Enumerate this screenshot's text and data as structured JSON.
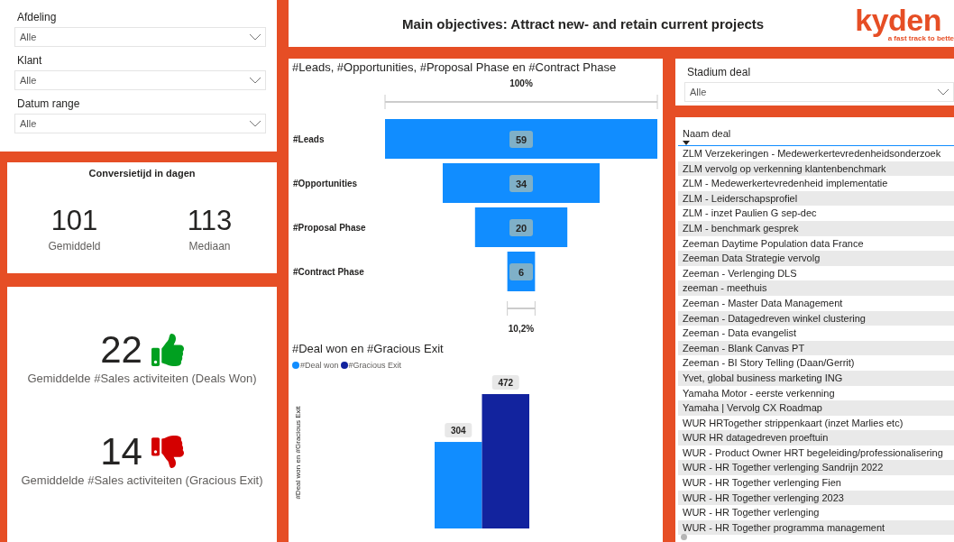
{
  "filters": [
    {
      "label": "Afdeling",
      "value": "Alle"
    },
    {
      "label": "Klant",
      "value": "Alle"
    },
    {
      "label": "Datum range",
      "value": "Alle"
    }
  ],
  "conversion": {
    "title": "Conversietijd in dagen",
    "stats": [
      {
        "value": "101",
        "label": "Gemiddeld"
      },
      {
        "value": "113",
        "label": "Mediaan"
      }
    ]
  },
  "sales_activities": [
    {
      "value": "22",
      "label": "Gemiddelde #Sales activiteiten (Deals Won)",
      "kind": "up"
    },
    {
      "value": "14",
      "label": "Gemiddelde #Sales activiteiten (Gracious Exit)",
      "kind": "down"
    }
  ],
  "header": {
    "title": "Main objectives: Attract new- and retain current projects",
    "logo": "kyden",
    "tagline": "a fast track to bette"
  },
  "funnel": {
    "title": "#Leads, #Opportunities, #Proposal Phase en #Contract Phase",
    "top_label": "100%",
    "bottom_label": "10,2%",
    "stages": [
      {
        "label": "#Leads",
        "value": "59"
      },
      {
        "label": "#Opportunities",
        "value": "34"
      },
      {
        "label": "#Proposal Phase",
        "value": "20"
      },
      {
        "label": "#Contract Phase",
        "value": "6"
      }
    ]
  },
  "deal_chart": {
    "title": "#Deal won en #Gracious Exit",
    "chart_data": {
      "type": "bar",
      "annotations": [
        {
          "text": "#Deal won en #Gracious Exit"
        }
      ],
      "data_labels": true,
      "series": [
        {
          "name": "#Deal won",
          "color": "#118dff",
          "values": [
            304
          ]
        },
        {
          "name": "#Gracious Exit",
          "color": "#12239e",
          "values": [
            472
          ]
        }
      ]
    }
  },
  "stage_filter": {
    "label": "Stadium deal",
    "value": "Alle"
  },
  "deals_table": {
    "column": "Naam deal",
    "rows": [
      "ZLM Verzekeringen - Medewerkertevredenheidsonderzoek",
      "ZLM vervolg op verkenning klantenbenchmark",
      "ZLM - Medewerkertevredenheid implementatie",
      "ZLM - Leiderschapsprofiel",
      "ZLM - inzet Paulien G sep-dec",
      "ZLM - benchmark gesprek",
      "Zeeman Daytime Population data France",
      "Zeeman Data Strategie vervolg",
      "Zeeman - Verlenging DLS",
      "zeeman - meethuis",
      "Zeeman - Master Data Management",
      "Zeeman - Datagedreven winkel clustering",
      "Zeeman - Data evangelist",
      "Zeeman - Blank Canvas PT",
      "Zeeman - BI Story Telling (Daan/Gerrit)",
      "Yvet, global business marketing ING",
      "Yamaha Motor - eerste verkenning",
      "Yamaha | Vervolg CX Roadmap",
      "WUR HRTogether strippenkaart (inzet Marlies etc)",
      "WUR HR datagedreven proeftuin",
      "WUR - Product Owner HRT begeleiding/professionalisering",
      "WUR - HR Together verlenging Sandrijn 2022",
      "WUR - HR Together verlenging Fien",
      "WUR - HR Together verlenging 2023",
      "WUR - HR Together verlenging",
      "WUR - HR Together programma management"
    ]
  }
}
